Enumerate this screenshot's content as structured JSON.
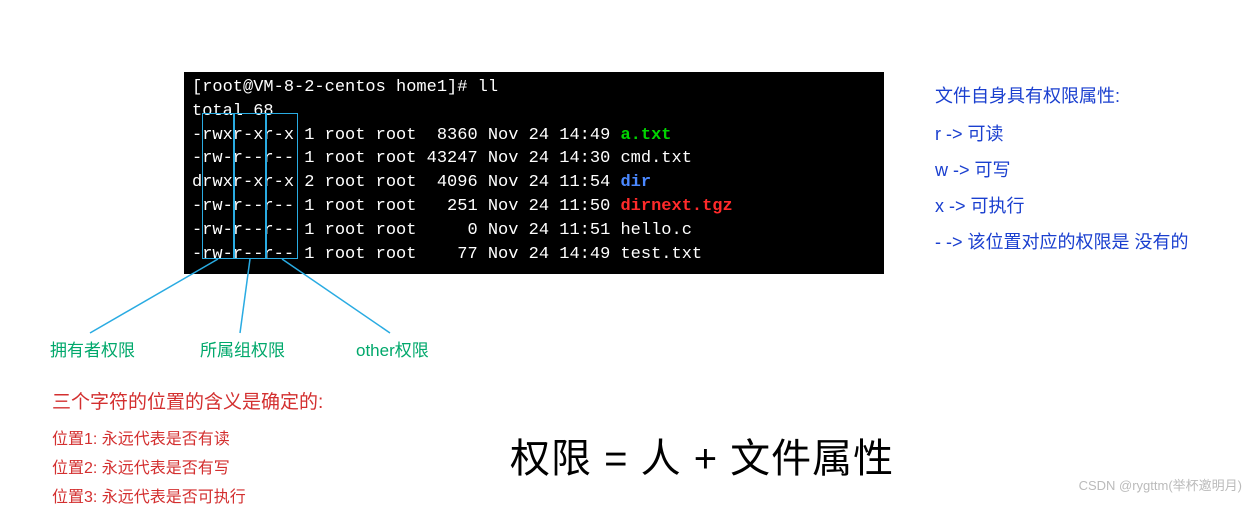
{
  "terminal": {
    "prompt": "[root@VM-8-2-centos home1]# ll",
    "total": "total 68",
    "rows": [
      {
        "perm": "-rwxr-xr-x",
        "links": "1",
        "owner": "root",
        "group": "root",
        "size": " 8360",
        "date": "Nov 24 14:49",
        "name": "a.txt",
        "cls": "green"
      },
      {
        "perm": "-rw-r--r--",
        "links": "1",
        "owner": "root",
        "group": "root",
        "size": "43247",
        "date": "Nov 24 14:30",
        "name": "cmd.txt",
        "cls": ""
      },
      {
        "perm": "drwxr-xr-x",
        "links": "2",
        "owner": "root",
        "group": "root",
        "size": " 4096",
        "date": "Nov 24 11:54",
        "name": "dir",
        "cls": "blue"
      },
      {
        "perm": "-rw-r--r--",
        "links": "1",
        "owner": "root",
        "group": "root",
        "size": "  251",
        "date": "Nov 24 11:50",
        "name": "dirnext.tgz",
        "cls": "red"
      },
      {
        "perm": "-rw-r--r--",
        "links": "1",
        "owner": "root",
        "group": "root",
        "size": "    0",
        "date": "Nov 24 11:51",
        "name": "hello.c",
        "cls": ""
      },
      {
        "perm": "-rw-r--r--",
        "links": "1",
        "owner": "root",
        "group": "root",
        "size": "   77",
        "date": "Nov 24 14:49",
        "name": "test.txt",
        "cls": ""
      }
    ]
  },
  "right": {
    "title": "文件自身具有权限属性:",
    "r": "r  ->   可读",
    "w": "w ->   可写",
    "x": "x  ->   可执行",
    "dash": "-  ->   该位置对应的权限是 没有的"
  },
  "labels": {
    "owner": "拥有者权限",
    "group": "所属组权限",
    "other": "other权限"
  },
  "red": {
    "heading": "三个字符的位置的含义是确定的:",
    "p1": "位置1:  永远代表是否有读",
    "p2": "位置2:  永远代表是否有写",
    "p3": "位置3:  永远代表是否可执行"
  },
  "equation": "权限 = 人 + 文件属性",
  "watermark": "CSDN @rygttm(举杯邀明月)"
}
